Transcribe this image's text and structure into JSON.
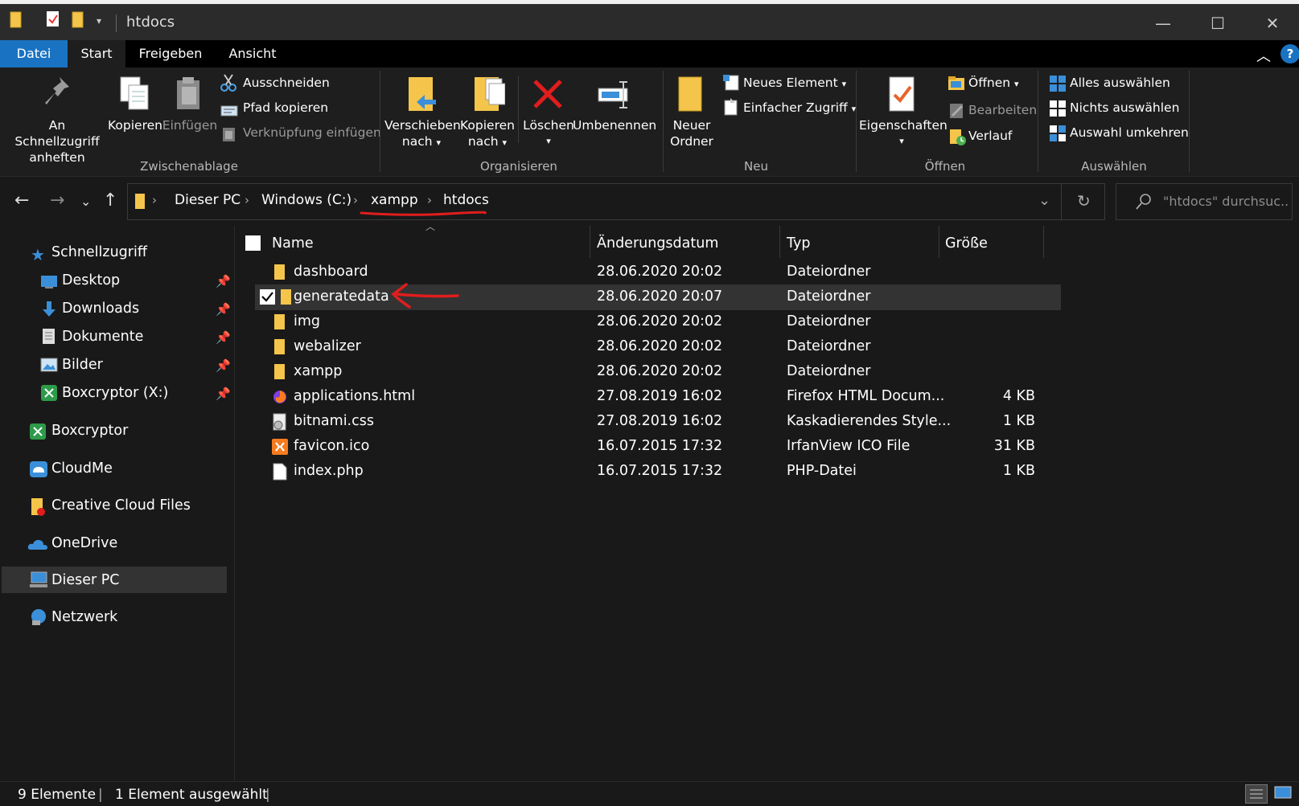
{
  "window": {
    "title": "htdocs"
  },
  "tabs": [
    {
      "label": "Datei"
    },
    {
      "label": "Start"
    },
    {
      "label": "Freigeben"
    },
    {
      "label": "Ansicht"
    }
  ],
  "ribbon": {
    "clipboard": {
      "pin_line1": "An Schnellzugriff",
      "pin_line2": "anheften",
      "copy": "Kopieren",
      "paste": "Einfügen",
      "cut": "Ausschneiden",
      "copy_path": "Pfad kopieren",
      "paste_shortcut": "Verknüpfung einfügen",
      "group": "Zwischenablage"
    },
    "organize": {
      "move_line1": "Verschieben",
      "move_line2": "nach",
      "copyto_line1": "Kopieren",
      "copyto_line2": "nach",
      "delete": "Löschen",
      "rename": "Umbenennen",
      "group": "Organisieren"
    },
    "new": {
      "folder_line1": "Neuer",
      "folder_line2": "Ordner",
      "new_item": "Neues Element",
      "easy_access": "Einfacher Zugriff",
      "group": "Neu"
    },
    "open": {
      "properties": "Eigenschaften",
      "open": "Öffnen",
      "edit": "Bearbeiten",
      "history": "Verlauf",
      "group": "Öffnen"
    },
    "select": {
      "select_all": "Alles auswählen",
      "select_none": "Nichts auswählen",
      "invert": "Auswahl umkehren",
      "group": "Auswählen"
    }
  },
  "address": {
    "crumbs": [
      "Dieser PC",
      "Windows (C:)",
      "xampp",
      "htdocs"
    ],
    "search_placeholder": "\"htdocs\" durchsuc..."
  },
  "nav": {
    "quick_access": "Schnellzugriff",
    "pinned": [
      "Desktop",
      "Downloads",
      "Dokumente",
      "Bilder",
      "Boxcryptor (X:)"
    ],
    "roots": [
      "Boxcryptor",
      "CloudMe",
      "Creative Cloud Files",
      "OneDrive",
      "Dieser PC",
      "Netzwerk"
    ]
  },
  "columns": {
    "name": "Name",
    "date": "Änderungsdatum",
    "type": "Typ",
    "size": "Größe"
  },
  "files": [
    {
      "name": "dashboard",
      "date": "28.06.2020 20:02",
      "type": "Dateiordner",
      "size": "",
      "icon": "folder-icon"
    },
    {
      "name": "generatedata",
      "date": "28.06.2020 20:07",
      "type": "Dateiordner",
      "size": "",
      "icon": "folder-icon",
      "selected": true
    },
    {
      "name": "img",
      "date": "28.06.2020 20:02",
      "type": "Dateiordner",
      "size": "",
      "icon": "folder-icon"
    },
    {
      "name": "webalizer",
      "date": "28.06.2020 20:02",
      "type": "Dateiordner",
      "size": "",
      "icon": "folder-icon"
    },
    {
      "name": "xampp",
      "date": "28.06.2020 20:02",
      "type": "Dateiordner",
      "size": "",
      "icon": "folder-icon"
    },
    {
      "name": "applications.html",
      "date": "27.08.2019 16:02",
      "type": "Firefox HTML Docum...",
      "size": "4 KB",
      "icon": "firefox-html-icon"
    },
    {
      "name": "bitnami.css",
      "date": "27.08.2019 16:02",
      "type": "Kaskadierendes Style...",
      "size": "1 KB",
      "icon": "css-file-icon"
    },
    {
      "name": "favicon.ico",
      "date": "16.07.2015 17:32",
      "type": "IrfanView ICO File",
      "size": "31 KB",
      "icon": "xampp-ico-icon"
    },
    {
      "name": "index.php",
      "date": "16.07.2015 17:32",
      "type": "PHP-Datei",
      "size": "1 KB",
      "icon": "blank-file-icon"
    }
  ],
  "status": {
    "count": "9 Elemente",
    "selection": "1 Element ausgewählt"
  },
  "colors": {
    "accent": "#1a73c2",
    "folder": "#f4c54a",
    "annotation": "#e11d1d"
  }
}
